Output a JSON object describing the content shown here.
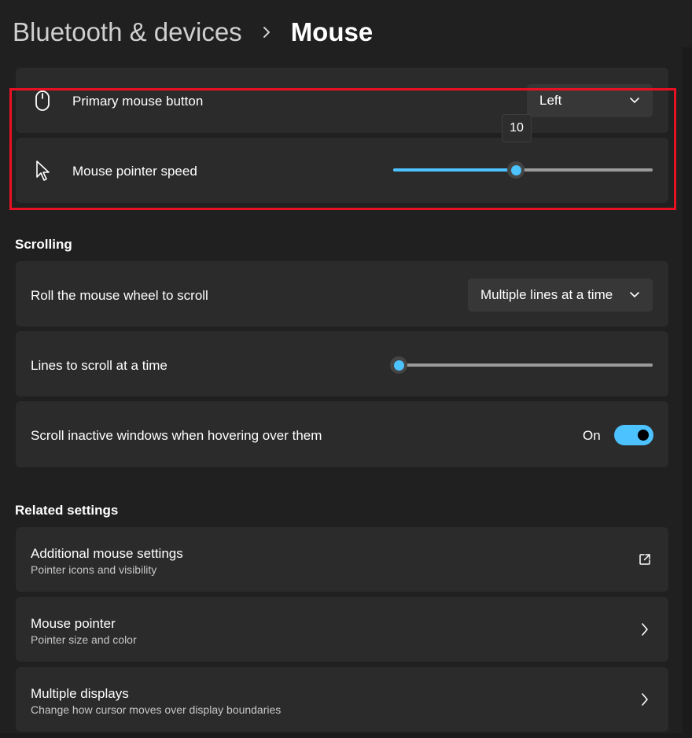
{
  "breadcrumb": {
    "parent": "Bluetooth & devices",
    "current": "Mouse",
    "separator_icon": "chevron-right-icon"
  },
  "mouse_settings": {
    "primary_button": {
      "label": "Primary mouse button",
      "icon": "mouse-icon",
      "value": "Left"
    },
    "pointer_speed": {
      "label": "Mouse pointer speed",
      "icon": "cursor-arrow-icon",
      "value": 10,
      "value_text": "10",
      "min": 1,
      "max": 20
    }
  },
  "scrolling": {
    "title": "Scrolling",
    "wheel_scroll": {
      "label": "Roll the mouse wheel to scroll",
      "value": "Multiple lines at a time"
    },
    "lines_to_scroll": {
      "label": "Lines to scroll at a time",
      "value": 3,
      "min": 1,
      "max": 100
    },
    "inactive_scroll": {
      "label": "Scroll inactive windows when hovering over them",
      "state_text": "On",
      "enabled": true
    }
  },
  "related": {
    "title": "Related settings",
    "items": [
      {
        "title": "Additional mouse settings",
        "subtitle": "Pointer icons and visibility",
        "icon": "open-external-icon"
      },
      {
        "title": "Mouse pointer",
        "subtitle": "Pointer size and color",
        "icon": "chevron-right-icon"
      },
      {
        "title": "Multiple displays",
        "subtitle": "Change how cursor moves over display boundaries",
        "icon": "chevron-right-icon"
      }
    ]
  },
  "colors": {
    "accent": "#4cc2ff",
    "background": "#202020",
    "card": "#2b2b2b",
    "highlight_border": "#e81123"
  }
}
